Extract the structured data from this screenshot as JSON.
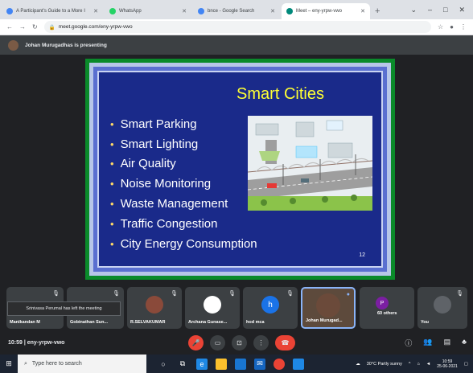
{
  "browser": {
    "tabs": [
      {
        "title": "A Participant's Guide to a More I",
        "active": false,
        "favicon_color": "#4285f4"
      },
      {
        "title": "WhatsApp",
        "active": false,
        "favicon_color": "#25d366"
      },
      {
        "title": "bnce - Google Search",
        "active": false,
        "favicon_color": "#4285f4"
      },
      {
        "title": "Meet – eny-yrpw-vwo",
        "active": true,
        "favicon_color": "#00897b"
      }
    ],
    "new_tab_label": "+",
    "url": "meet.google.com/eny-yrpw-vwo",
    "window_controls": [
      "⌄",
      "–",
      "□",
      "✕"
    ]
  },
  "meet": {
    "presenting_text": "Johan Murugadhas is presenting",
    "slide": {
      "title": "Smart Cities",
      "bullets": [
        "Smart Parking",
        "Smart Lighting",
        "Air Quality",
        "Noise Monitoring",
        "Waste Management",
        "Traffic Congestion",
        "City Energy Consumption"
      ],
      "page_number": "12"
    },
    "participants": [
      {
        "name": "Manikandan M",
        "initial": "",
        "color": "#5f6368"
      },
      {
        "name": "Gobinathan Sun...",
        "initial": "",
        "color": "#5f6368"
      },
      {
        "name": "R.SELVAKUMAR",
        "initial": "",
        "color": "#8a4a3a"
      },
      {
        "name": "Archana Gunase...",
        "initial": "",
        "color": "#ffffff"
      },
      {
        "name": "hod mca",
        "initial": "h",
        "color": "#1a73e8"
      },
      {
        "name": "Johan Murugad...",
        "initial": "",
        "color": "#6b4a3a"
      },
      {
        "name": "60 others",
        "initial": "P",
        "color": "#7b1fa2"
      },
      {
        "name": "You",
        "initial": "",
        "color": "#5f6368"
      }
    ],
    "toast": "Srinivasa Perumal has left the meeting",
    "meeting_info": "10:59 | eny-yrpw-vwo"
  },
  "taskbar": {
    "search_placeholder": "Type here to search",
    "weather": "30°C Partly sunny",
    "time": "10:59",
    "date": "25-06-2021"
  }
}
